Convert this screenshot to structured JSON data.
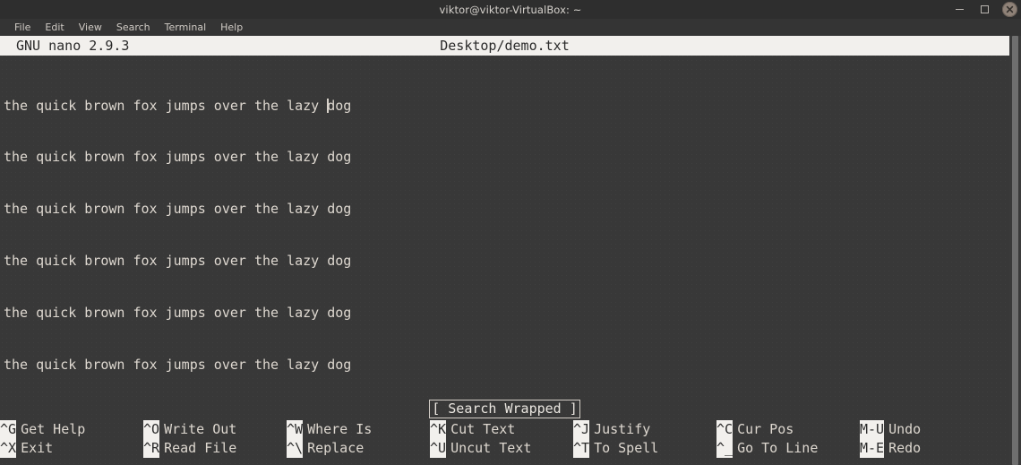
{
  "window": {
    "title": "viktor@viktor-VirtualBox: ~",
    "controls": {
      "minimize": "minimize",
      "maximize": "maximize",
      "close": "close"
    }
  },
  "menubar": {
    "items": [
      {
        "label": "File"
      },
      {
        "label": "Edit"
      },
      {
        "label": "View"
      },
      {
        "label": "Search"
      },
      {
        "label": "Terminal"
      },
      {
        "label": "Help"
      }
    ]
  },
  "nano": {
    "version": "GNU nano 2.9.3",
    "filename": "Desktop/demo.txt",
    "status_message": "[ Search Wrapped ]",
    "buffer": {
      "lines": [
        "the quick brown fox jumps over the lazy ",
        "the quick brown fox jumps over the lazy dog",
        "the quick brown fox jumps over the lazy dog",
        "the quick brown fox jumps over the lazy dog",
        "the quick brown fox jumps over the lazy dog",
        "the quick brown fox jumps over the lazy dog"
      ],
      "cursor_line_tail": "dog"
    },
    "shortcuts_row1": [
      {
        "key": "^G",
        "label": "Get Help"
      },
      {
        "key": "^O",
        "label": "Write Out"
      },
      {
        "key": "^W",
        "label": "Where Is"
      },
      {
        "key": "^K",
        "label": "Cut Text"
      },
      {
        "key": "^J",
        "label": "Justify"
      },
      {
        "key": "^C",
        "label": "Cur Pos"
      },
      {
        "key": "M-U",
        "label": "Undo"
      }
    ],
    "shortcuts_row2": [
      {
        "key": "^X",
        "label": "Exit"
      },
      {
        "key": "^R",
        "label": "Read File"
      },
      {
        "key": "^\\",
        "label": "Replace"
      },
      {
        "key": "^U",
        "label": "Uncut Text"
      },
      {
        "key": "^T",
        "label": "To Spell"
      },
      {
        "key": "^_",
        "label": "Go To Line"
      },
      {
        "key": "M-E",
        "label": "Redo"
      }
    ]
  },
  "colors": {
    "terminal_bg": "#383838",
    "titlebar_bg": "#2e2e2e",
    "menubar_bg": "#343434",
    "nano_bar_bg": "#f2f0ed",
    "text_fg": "#ded8d0",
    "close_button": "#8f8278"
  }
}
